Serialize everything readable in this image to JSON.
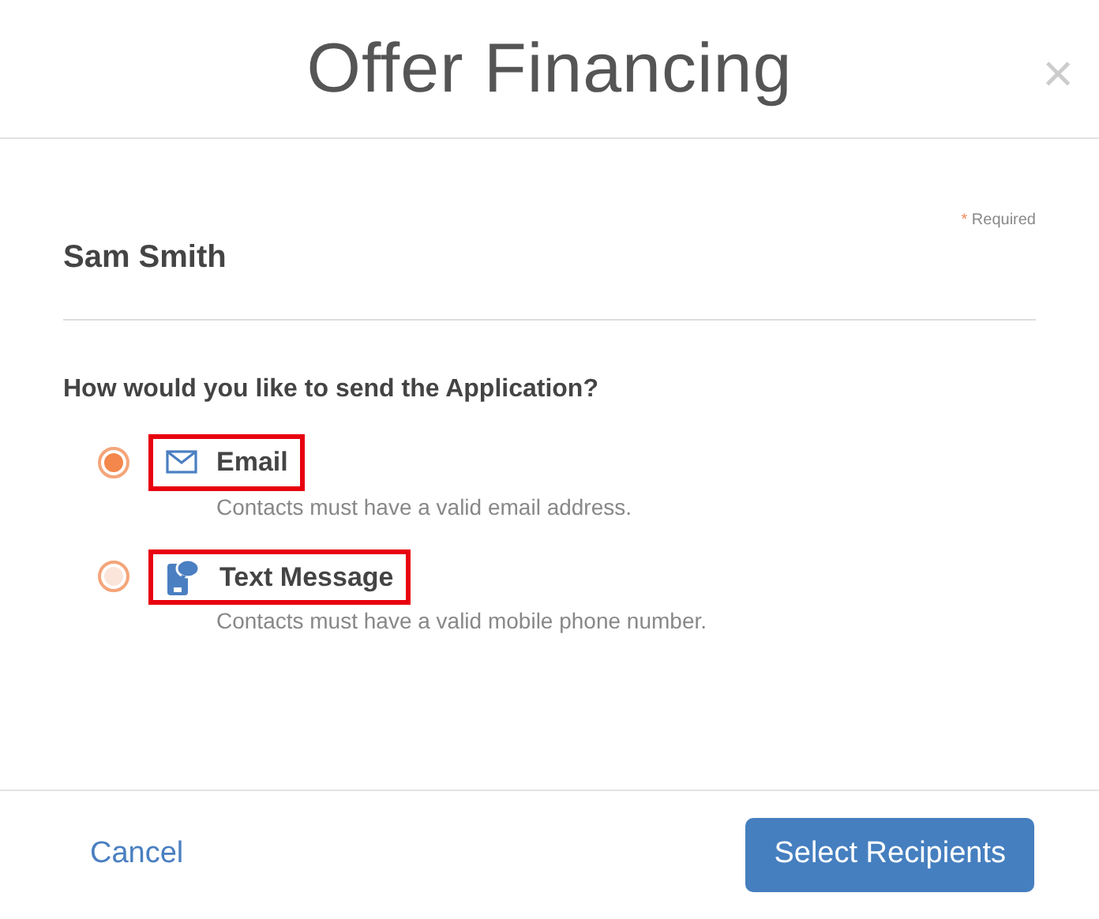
{
  "header": {
    "title": "Offer Financing",
    "close": "×"
  },
  "required_note": {
    "mark": "*",
    "text": "Required"
  },
  "recipient_name": "Sam Smith",
  "question": "How would you like to send the Application?",
  "options": [
    {
      "kind": "email",
      "label": "Email",
      "hint": "Contacts must have a valid email address.",
      "selected": true,
      "highlighted": true
    },
    {
      "kind": "text",
      "label": "Text Message",
      "hint": "Contacts must have a valid mobile phone number.",
      "selected": false,
      "highlighted": true
    }
  ],
  "footer": {
    "cancel": "Cancel",
    "submit": "Select Recipients"
  }
}
